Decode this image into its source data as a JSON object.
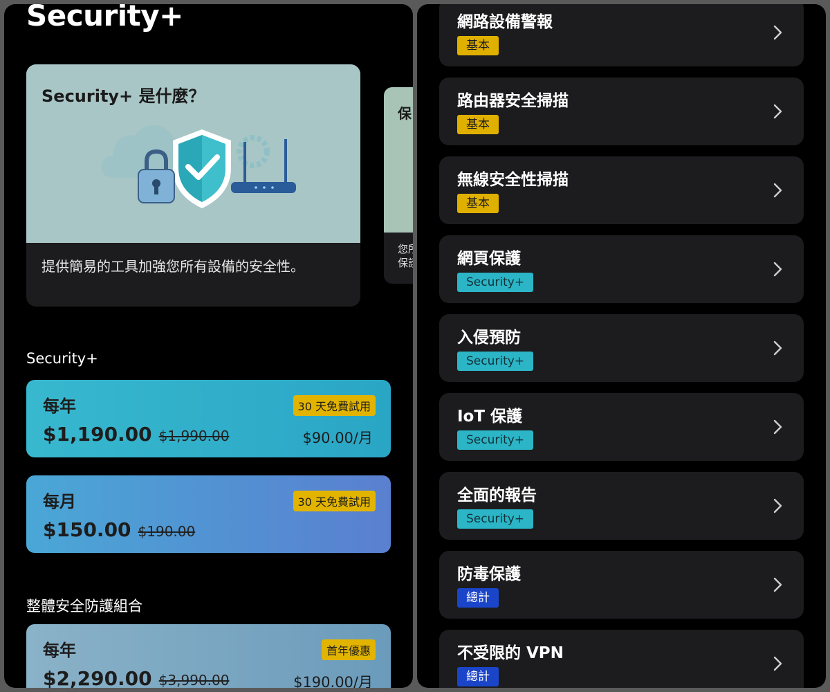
{
  "app": {
    "title": "Security+"
  },
  "hero": {
    "title": "Security+ 是什麼？",
    "description": "提供簡易的工具加強您所有設備的安全性。"
  },
  "peek_card": {
    "title": "保",
    "desc_line1": "您所",
    "desc_line2": "保護"
  },
  "sections": {
    "security_plus": "Security+",
    "bundle": "整體安全防護組合"
  },
  "plans": [
    {
      "period": "每年",
      "price": "$1,190.00",
      "old_price": "$1,990.00",
      "badge": "30 天免費試用",
      "monthly": "$90.00/月"
    },
    {
      "period": "每月",
      "price": "$150.00",
      "old_price": "$190.00",
      "badge": "30 天免費試用",
      "monthly": ""
    },
    {
      "period": "每年",
      "price": "$2,290.00",
      "old_price": "$3,990.00",
      "badge": "首年優惠",
      "monthly": "$190.00/月"
    }
  ],
  "features": [
    {
      "name": "網路設備警報",
      "tag": "基本",
      "tag_type": "basic"
    },
    {
      "name": "路由器安全掃描",
      "tag": "基本",
      "tag_type": "basic"
    },
    {
      "name": "無線安全性掃描",
      "tag": "基本",
      "tag_type": "basic"
    },
    {
      "name": "網頁保護",
      "tag": "Security+",
      "tag_type": "plus"
    },
    {
      "name": "入侵預防",
      "tag": "Security+",
      "tag_type": "plus"
    },
    {
      "name": "IoT 保護",
      "tag": "Security+",
      "tag_type": "plus"
    },
    {
      "name": "全面的報告",
      "tag": "Security+",
      "tag_type": "plus"
    },
    {
      "name": "防毒保護",
      "tag": "總計",
      "tag_type": "total"
    },
    {
      "name": "不受限的 VPN",
      "tag": "總計",
      "tag_type": "total"
    }
  ],
  "icons": {
    "hero": [
      "cloud-icon",
      "padlock-icon",
      "shield-check-icon",
      "gear-icon",
      "router-icon"
    ],
    "feature_arrow": "chevron-right-icon"
  },
  "colors": {
    "background": "#000000",
    "card": "#1c1c1e",
    "tag_basic": "#e0b000",
    "tag_security_plus": "#2bb5c6",
    "tag_total": "#1b45c9",
    "badge_trial": "#e2b400"
  }
}
